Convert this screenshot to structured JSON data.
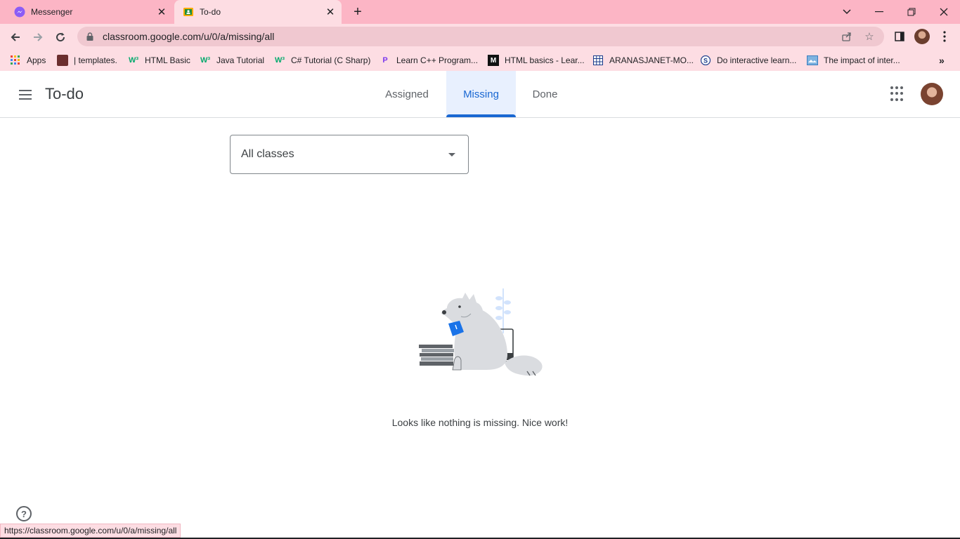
{
  "browser": {
    "tabs": [
      {
        "title": "Messenger",
        "icon": "messenger-icon",
        "active": false
      },
      {
        "title": "To-do",
        "icon": "classroom-icon",
        "active": true
      }
    ],
    "url": "classroom.google.com/u/0/a/missing/all",
    "status_url": "https://classroom.google.com/u/0/a/missing/all",
    "bookmarks": [
      {
        "label": "Apps",
        "icon": "apps-grid-icon"
      },
      {
        "label": "| templates.",
        "icon": "image-icon"
      },
      {
        "label": "HTML Basic",
        "icon": "w3schools-icon"
      },
      {
        "label": "Java Tutorial",
        "icon": "w3schools-icon"
      },
      {
        "label": "C# Tutorial (C Sharp)",
        "icon": "w3schools-icon"
      },
      {
        "label": "Learn C++ Program...",
        "icon": "learn-icon"
      },
      {
        "label": "HTML basics - Lear...",
        "icon": "mdn-icon"
      },
      {
        "label": "ARANASJANET-MO...",
        "icon": "calendar-grid-icon"
      },
      {
        "label": "Do interactive learn...",
        "icon": "sololearn-icon"
      },
      {
        "label": "The impact of inter...",
        "icon": "document-icon"
      }
    ],
    "colors": {
      "frame": "#fcb5c5",
      "toolbar": "#fddde3"
    }
  },
  "app": {
    "title": "To-do",
    "tabs": [
      "Assigned",
      "Missing",
      "Done"
    ],
    "active_tab": "Missing",
    "class_filter": "All classes",
    "empty_message": "Looks like nothing is missing. Nice work!",
    "accent": "#1967d2"
  }
}
